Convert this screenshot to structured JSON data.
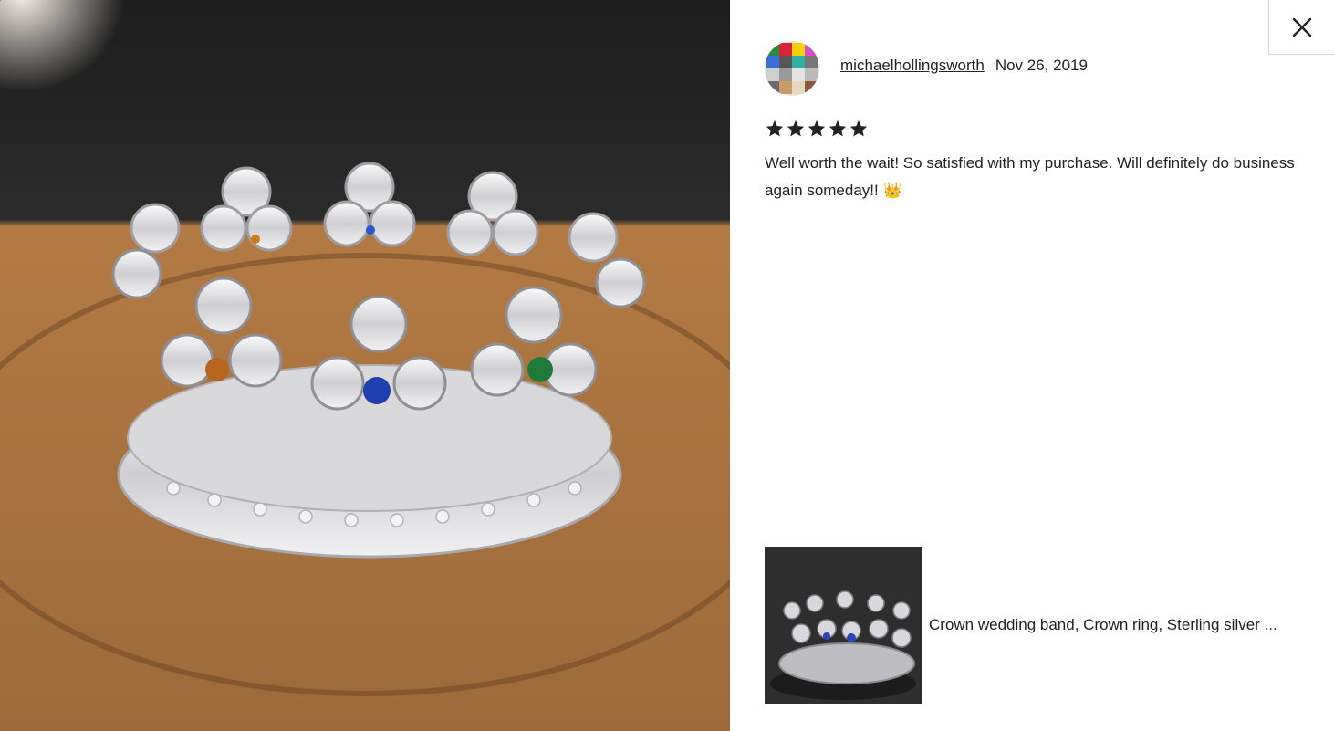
{
  "review": {
    "author": "michaelhollingsworth",
    "date": "Nov 26, 2019",
    "rating": 5,
    "text": "Well worth the wait! So satisfied with my purchase. Will definitely do business again someday!! 👑"
  },
  "listing": {
    "title": "Crown wedding band, Crown ring, Sterling silver ..."
  },
  "icons": {
    "close": "close-icon",
    "star": "star-icon",
    "avatar": "avatar"
  },
  "colors": {
    "text": "#222222",
    "border": "#d6d6d6",
    "wood": "#b07a45",
    "silver": "#e8e8ea"
  }
}
